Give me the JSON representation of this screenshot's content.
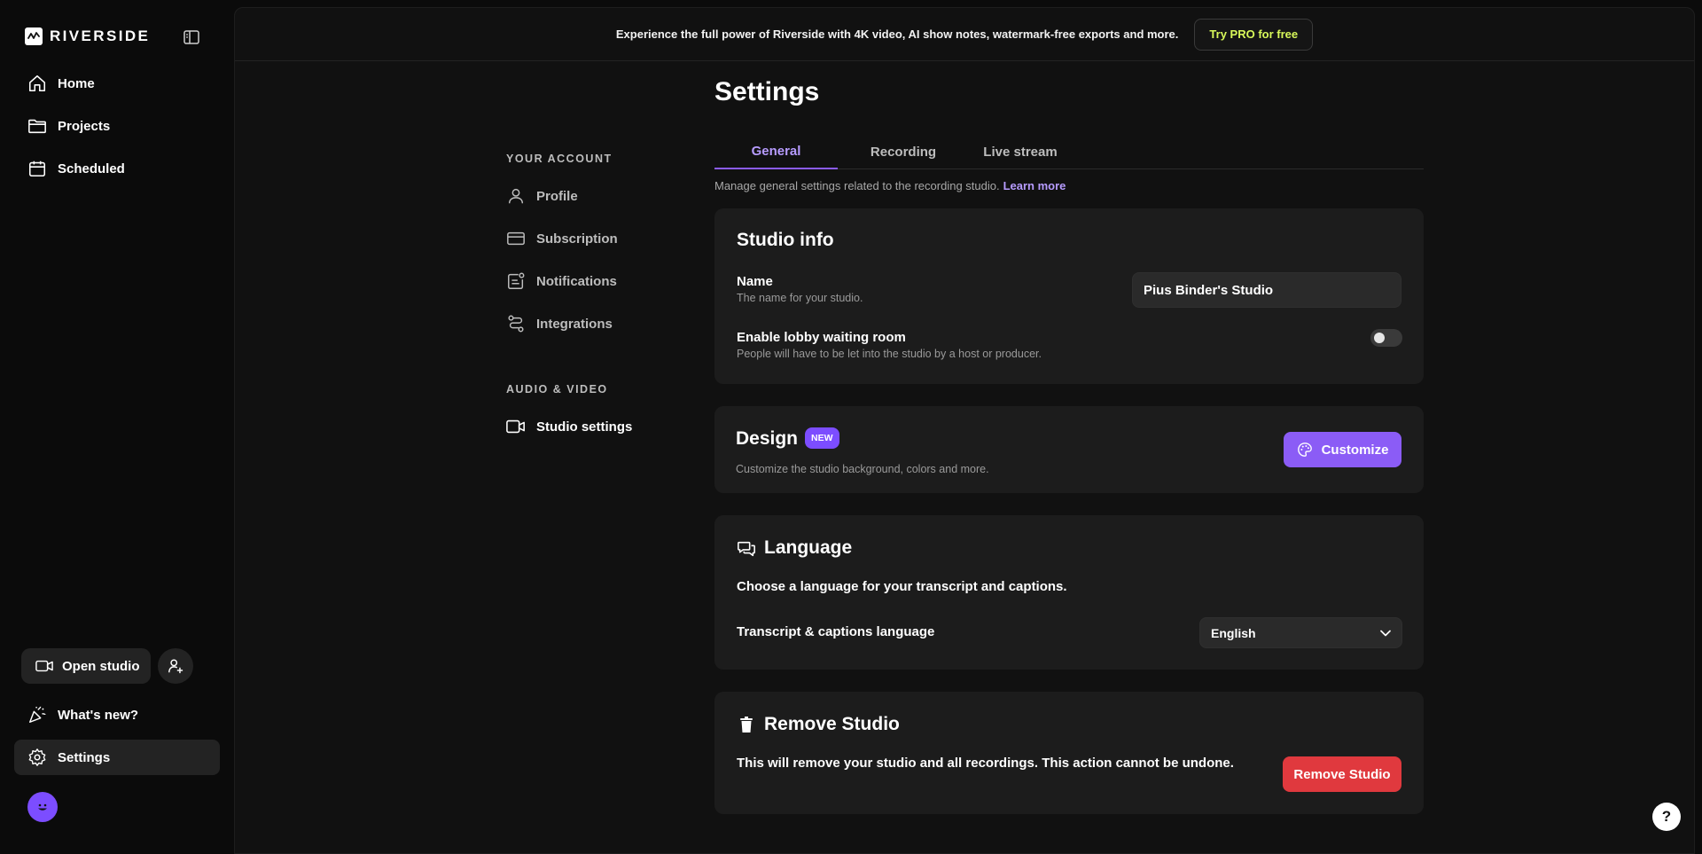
{
  "app": {
    "name": "RIVERSIDE"
  },
  "sidebar": {
    "nav": [
      {
        "label": "Home",
        "icon": "home-icon"
      },
      {
        "label": "Projects",
        "icon": "folder-icon"
      },
      {
        "label": "Scheduled",
        "icon": "calendar-icon"
      }
    ],
    "open_studio": "Open studio",
    "whats_new": "What's new?",
    "settings": "Settings"
  },
  "promo": {
    "text": "Experience the full power of Riverside with 4K video, AI show notes, watermark-free exports and more.",
    "cta": "Try PRO for free"
  },
  "settings": {
    "title": "Settings",
    "sections": [
      {
        "heading": "YOUR ACCOUNT",
        "items": [
          {
            "label": "Profile",
            "icon": "user-icon"
          },
          {
            "label": "Subscription",
            "icon": "credit-card-icon"
          },
          {
            "label": "Notifications",
            "icon": "notification-icon"
          },
          {
            "label": "Integrations",
            "icon": "integrations-icon"
          }
        ]
      },
      {
        "heading": "AUDIO & VIDEO",
        "items": [
          {
            "label": "Studio settings",
            "icon": "video-camera-icon",
            "active": true
          }
        ]
      }
    ],
    "tabs": [
      "General",
      "Recording",
      "Live stream"
    ],
    "active_tab": "General",
    "intro": "Manage general settings related to the recording studio.",
    "learn_more": "Learn more"
  },
  "studio_info": {
    "title": "Studio info",
    "name_label": "Name",
    "name_desc": "The name for your studio.",
    "name_value": "Pius Binder's Studio",
    "lobby_label": "Enable lobby waiting room",
    "lobby_desc": "People will have to be let into the studio by a host or producer.",
    "lobby_enabled": false
  },
  "design": {
    "title": "Design",
    "badge": "NEW",
    "desc": "Customize the studio background, colors and more.",
    "button": "Customize"
  },
  "language": {
    "title": "Language",
    "desc": "Choose a language for your transcript and captions.",
    "select_label": "Transcript & captions language",
    "selected": "English"
  },
  "remove": {
    "title": "Remove Studio",
    "desc": "This will remove your studio and all recordings. This action cannot be undone.",
    "button": "Remove Studio"
  },
  "help": "?",
  "colors": {
    "accent": "#8b5cf6",
    "danger": "#e0393e",
    "promo": "#d8f85a"
  }
}
